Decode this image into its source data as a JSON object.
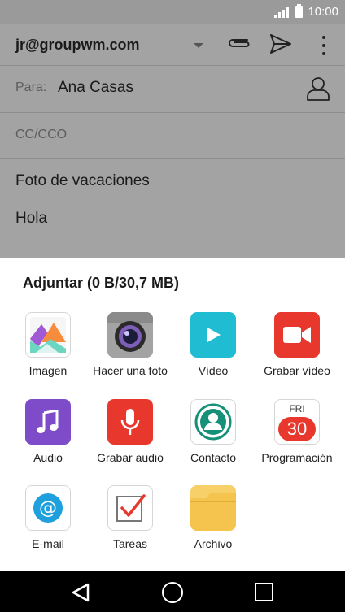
{
  "status_bar": {
    "time": "10:00"
  },
  "compose": {
    "account": "jr@groupwm.com",
    "to_label": "Para:",
    "to_value": "Ana Casas",
    "cc_label": "CC/CCO",
    "subject": "Foto de vacaciones",
    "body": "Hola"
  },
  "attach_sheet": {
    "title": "Adjuntar (0 B/30,7 MB)",
    "items": [
      {
        "label": "Imagen",
        "icon": "gallery-icon"
      },
      {
        "label": "Hacer una foto",
        "icon": "camera-icon"
      },
      {
        "label": "Vídeo",
        "icon": "video-play-icon"
      },
      {
        "label": "Grabar vídeo",
        "icon": "video-camera-icon"
      },
      {
        "label": "Audio",
        "icon": "music-note-icon"
      },
      {
        "label": "Grabar audio",
        "icon": "microphone-icon"
      },
      {
        "label": "Contacto",
        "icon": "contact-icon"
      },
      {
        "label": "Programación",
        "icon": "calendar-icon",
        "calendar_day": "FRI",
        "calendar_date": "30"
      },
      {
        "label": "E-mail",
        "icon": "at-sign-icon"
      },
      {
        "label": "Tareas",
        "icon": "tasks-check-icon"
      },
      {
        "label": "Archivo",
        "icon": "folder-icon"
      }
    ]
  },
  "colors": {
    "dimmed": "#a3a3a3",
    "video_cyan": "#1fbcd2",
    "record_red": "#e8382e",
    "audio_purple": "#7e4cc8",
    "email_blue": "#1ea0dd",
    "contact_teal": "#17907a",
    "folder_yellow": "#f5c44e"
  }
}
